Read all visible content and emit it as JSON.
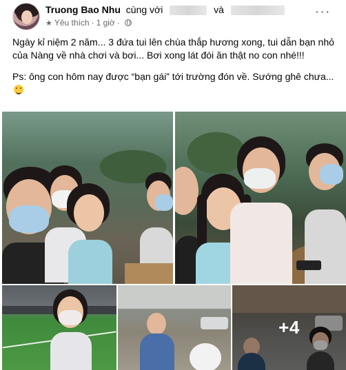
{
  "post": {
    "author_name": "Truong Bao Nhu",
    "with_text": "cùng với",
    "and_text": "và",
    "audience_label": "Yêu thích",
    "time": "1 giờ",
    "more_label": "···",
    "body_paragraphs": [
      "Ngày kỉ niệm 2 năm... 3 đứa tui lên chùa thắp hương xong, tui dẫn bạn nhỏ của Nàng về nhà chơi và bơi... Bơi xong lát đói ăn thật no con nhé!!!",
      "Ps: ông con hôm nay được “bạn gái” tới trường đón về. Sướng ghê chưa..."
    ],
    "extra_photos_label": "+4"
  },
  "icons": {
    "audience": "star-icon",
    "privacy": "globe-icon",
    "more": "more-horizontal-icon",
    "emoji": "grinning-face-emoji"
  },
  "colors": {
    "text": "#050505",
    "secondary_text": "#65676b"
  }
}
